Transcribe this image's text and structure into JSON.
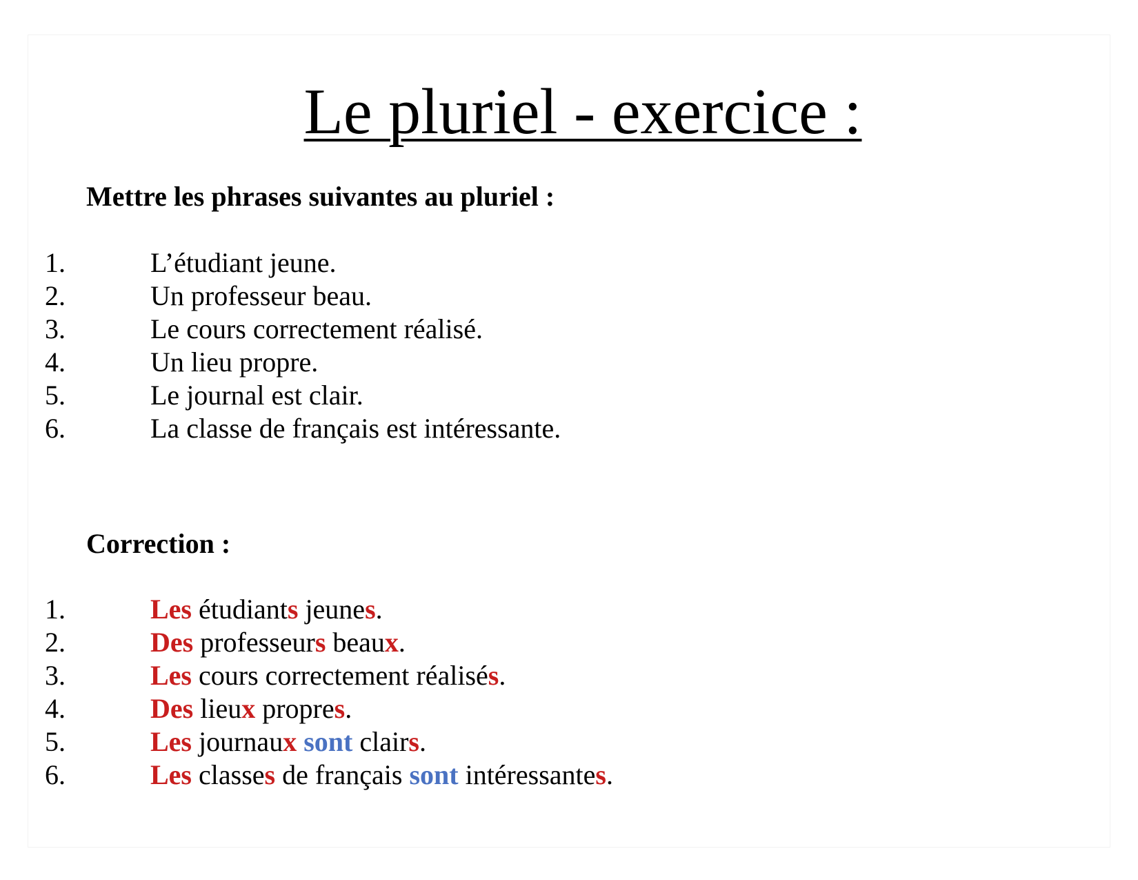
{
  "title": "Le pluriel - exercice :",
  "instruction": "Mettre les phrases suivantes au pluriel :",
  "exercise": [
    {
      "number": "1.",
      "text": "L’étudiant jeune."
    },
    {
      "number": "2.",
      "text": "Un professeur beau."
    },
    {
      "number": "3.",
      "text": "Le cours correctement réalisé."
    },
    {
      "number": "4.",
      "text": "Un lieu propre."
    },
    {
      "number": "5.",
      "text": "Le journal est clair."
    },
    {
      "number": "6.",
      "text": "La classe de français est intéressante."
    }
  ],
  "correction_heading": "Correction :",
  "correction": [
    {
      "number": "1.",
      "parts": [
        {
          "t": "Les",
          "s": "red"
        },
        {
          "t": " étudiant",
          "s": ""
        },
        {
          "t": "s",
          "s": "red"
        },
        {
          "t": " jeune",
          "s": ""
        },
        {
          "t": "s",
          "s": "red"
        },
        {
          "t": ".",
          "s": ""
        }
      ]
    },
    {
      "number": "2.",
      "parts": [
        {
          "t": "Des",
          "s": "red"
        },
        {
          "t": " professeur",
          "s": ""
        },
        {
          "t": "s",
          "s": "red"
        },
        {
          "t": " beau",
          "s": ""
        },
        {
          "t": "x",
          "s": "red"
        },
        {
          "t": ".",
          "s": ""
        }
      ]
    },
    {
      "number": "3.",
      "parts": [
        {
          "t": "Les",
          "s": "red"
        },
        {
          "t": " cours correctement réalisé",
          "s": ""
        },
        {
          "t": "s",
          "s": "red"
        },
        {
          "t": ".",
          "s": ""
        }
      ]
    },
    {
      "number": "4.",
      "parts": [
        {
          "t": "Des",
          "s": "red"
        },
        {
          "t": " lieu",
          "s": ""
        },
        {
          "t": "x",
          "s": "red"
        },
        {
          "t": " propre",
          "s": ""
        },
        {
          "t": "s",
          "s": "red"
        },
        {
          "t": ".",
          "s": ""
        }
      ]
    },
    {
      "number": "5.",
      "parts": [
        {
          "t": "Les",
          "s": "red"
        },
        {
          "t": " journau",
          "s": ""
        },
        {
          "t": "x",
          "s": "red"
        },
        {
          "t": " ",
          "s": ""
        },
        {
          "t": "sont",
          "s": "blue"
        },
        {
          "t": " clair",
          "s": ""
        },
        {
          "t": "s",
          "s": "red"
        },
        {
          "t": ".",
          "s": ""
        }
      ]
    },
    {
      "number": "6.",
      "parts": [
        {
          "t": "Les",
          "s": "red"
        },
        {
          "t": " classe",
          "s": ""
        },
        {
          "t": "s",
          "s": "red"
        },
        {
          "t": " de français ",
          "s": ""
        },
        {
          "t": "sont",
          "s": "blue"
        },
        {
          "t": " intéressante",
          "s": ""
        },
        {
          "t": "s",
          "s": "red"
        },
        {
          "t": ".",
          "s": ""
        }
      ]
    }
  ],
  "colors": {
    "plural_marker": "#c81e1e",
    "verb_marker": "#4a72c2"
  }
}
